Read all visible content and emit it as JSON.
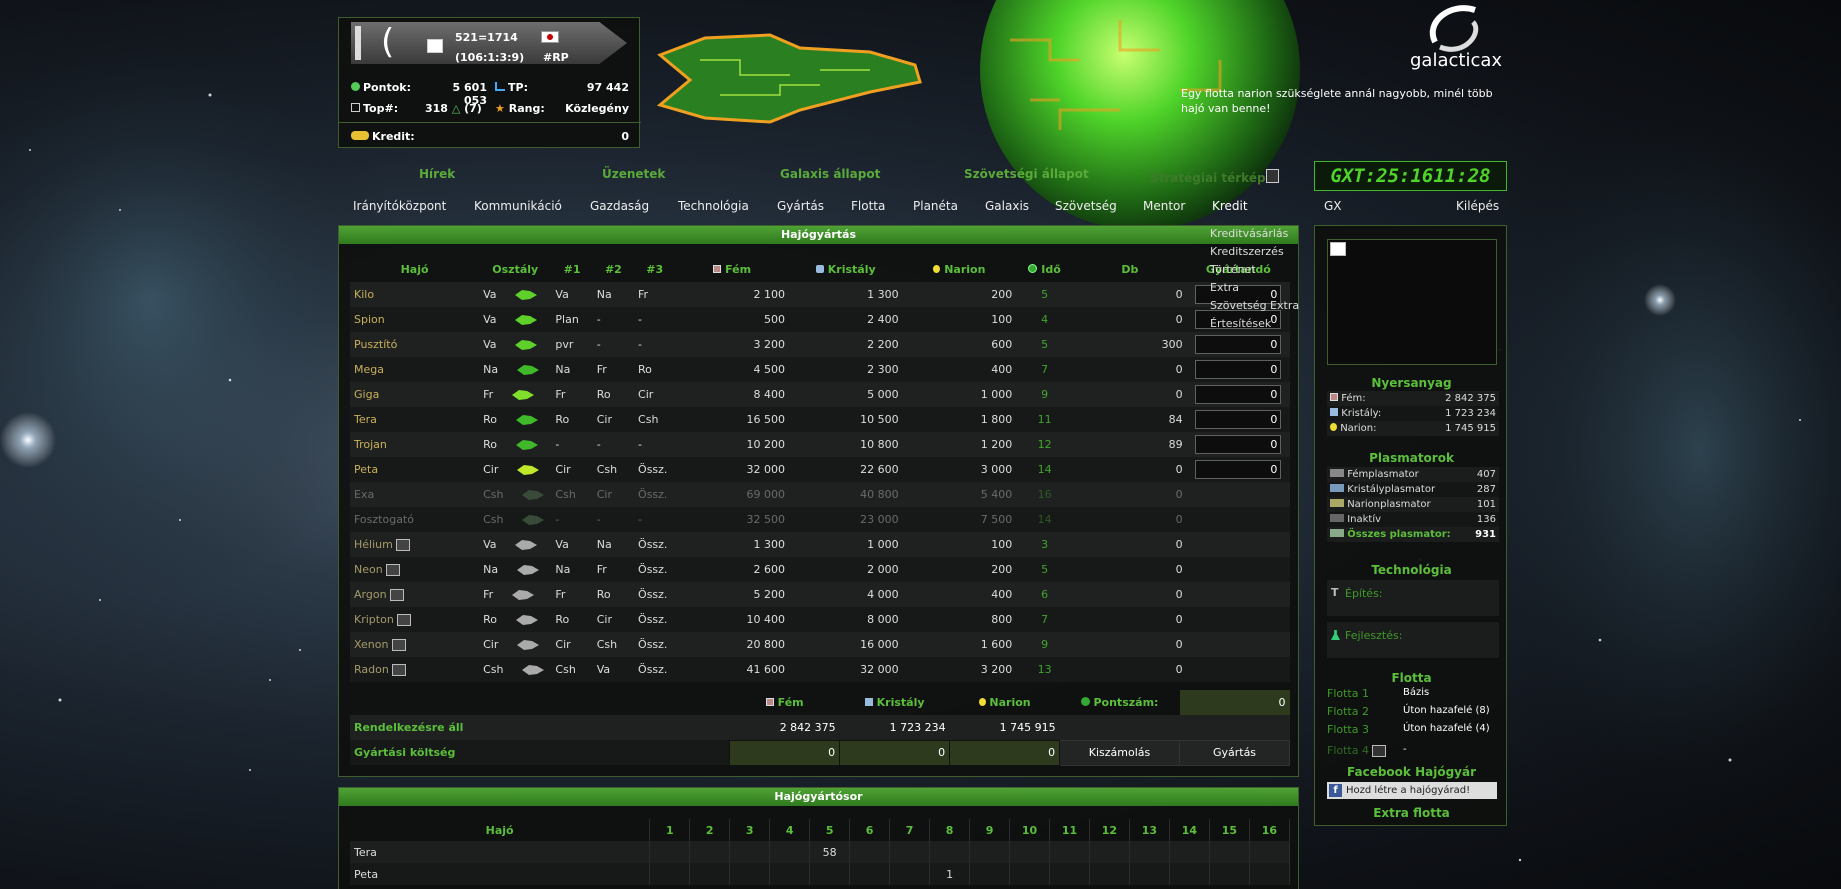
{
  "header": {
    "coord_line1": "521=1714",
    "coord_line2": "(106:1:3:9)",
    "tag": "#RP",
    "stats": [
      {
        "label": "Pontok:",
        "value": "5 601 053"
      },
      {
        "label": "TP:",
        "value": "97 442"
      },
      {
        "label": "Top#:",
        "value": "318",
        "extra": "(7)"
      },
      {
        "label": "Rang:",
        "value": "Közlegény"
      },
      {
        "label": "Kredit:",
        "value": "0"
      }
    ],
    "logo": "galacticax",
    "tip": "Egy flotta narion szükséglete annál nagyobb, minél több hajó van benne!",
    "clock": "GXT:25:1611:28"
  },
  "subnav": [
    "Hírek",
    "Üzenetek",
    "Galaxis állapot",
    "Szövetségi állapot",
    "Stratégiai térkép"
  ],
  "nav": [
    "Irányítóközpont",
    "Kommunikáció",
    "Gazdaság",
    "Technológia",
    "Gyártás",
    "Flotta",
    "Planéta",
    "Galaxis",
    "Szövetség",
    "Mentor",
    "Kredit",
    "GX",
    "Kilépés"
  ],
  "kredit_menu": [
    "Kreditvásárlás",
    "Kreditszerzés",
    "Történet",
    "Extra",
    "Szövetség Extra",
    "Értesítések"
  ],
  "production": {
    "title": "Hajógyártás",
    "columns": [
      "Hajó",
      "Osztály",
      "#1",
      "#2",
      "#3",
      "Fém",
      "Kristály",
      "Narion",
      "Idő",
      "Db",
      "Gyártandó"
    ],
    "ships": [
      {
        "name": "Kilo",
        "cls": "Va",
        "t1": "Va",
        "t2": "Na",
        "t3": "Fr",
        "fem": "2 100",
        "kris": "1 300",
        "nar": "200",
        "ido": "5",
        "db": "0",
        "q": "0",
        "dim": false,
        "color": "#5fcf2a"
      },
      {
        "name": "Spion",
        "cls": "Va",
        "t1": "Plan",
        "t2": "-",
        "t3": "-",
        "fem": "500",
        "kris": "2 400",
        "nar": "100",
        "ido": "4",
        "db": "0",
        "q": "0",
        "dim": false,
        "color": "#5fcf2a"
      },
      {
        "name": "Pusztító",
        "cls": "Va",
        "t1": "pvr",
        "t2": "-",
        "t3": "-",
        "fem": "3 200",
        "kris": "2 200",
        "nar": "600",
        "ido": "5",
        "db": "300",
        "q": "0",
        "dim": false,
        "color": "#5fcf2a"
      },
      {
        "name": "Mega",
        "cls": "Na",
        "t1": "Na",
        "t2": "Fr",
        "t3": "Ro",
        "fem": "4 500",
        "kris": "2 300",
        "nar": "400",
        "ido": "7",
        "db": "0",
        "q": "0",
        "dim": false,
        "color": "#3fb82a"
      },
      {
        "name": "Giga",
        "cls": "Fr",
        "t1": "Fr",
        "t2": "Ro",
        "t3": "Cir",
        "fem": "8 400",
        "kris": "5 000",
        "nar": "1 000",
        "ido": "9",
        "db": "0",
        "q": "0",
        "dim": false,
        "color": "#7fdf2a"
      },
      {
        "name": "Tera",
        "cls": "Ro",
        "t1": "Ro",
        "t2": "Cir",
        "t3": "Csh",
        "fem": "16 500",
        "kris": "10 500",
        "nar": "1 800",
        "ido": "11",
        "db": "84",
        "q": "0",
        "dim": false,
        "color": "#3fb82a"
      },
      {
        "name": "Trojan",
        "cls": "Ro",
        "t1": "-",
        "t2": "-",
        "t3": "-",
        "fem": "10 200",
        "kris": "10 800",
        "nar": "1 200",
        "ido": "12",
        "db": "89",
        "q": "0",
        "dim": false,
        "color": "#3fb82a"
      },
      {
        "name": "Peta",
        "cls": "Cir",
        "t1": "Cir",
        "t2": "Csh",
        "t3": "Össz.",
        "fem": "32 000",
        "kris": "22 600",
        "nar": "3 000",
        "ido": "14",
        "db": "0",
        "q": "0",
        "dim": false,
        "color": "#bfe82a"
      },
      {
        "name": "Exa",
        "cls": "Csh",
        "t1": "Csh",
        "t2": "Cir",
        "t3": "Össz.",
        "fem": "69 000",
        "kris": "40 800",
        "nar": "5 400",
        "ido": "16",
        "db": "0",
        "q": "",
        "dim": true,
        "color": "#3a4a3a"
      },
      {
        "name": "Fosztogató",
        "cls": "Csh",
        "t1": "-",
        "t2": "-",
        "t3": "-",
        "fem": "32 500",
        "kris": "23 000",
        "nar": "7 500",
        "ido": "14",
        "db": "0",
        "q": "",
        "dim": true,
        "color": "#3a4a3a"
      },
      {
        "name": "Hélium",
        "cls": "Va",
        "t1": "Va",
        "t2": "Na",
        "t3": "Össz.",
        "fem": "1 300",
        "kris": "1 000",
        "nar": "100",
        "ido": "3",
        "db": "0",
        "q": "",
        "dim": false,
        "color": "#aaaaaa"
      },
      {
        "name": "Neon",
        "cls": "Na",
        "t1": "Na",
        "t2": "Fr",
        "t3": "Össz.",
        "fem": "2 600",
        "kris": "2 000",
        "nar": "200",
        "ido": "5",
        "db": "0",
        "q": "",
        "dim": false,
        "color": "#aaaaaa"
      },
      {
        "name": "Argon",
        "cls": "Fr",
        "t1": "Fr",
        "t2": "Ro",
        "t3": "Össz.",
        "fem": "5 200",
        "kris": "4 000",
        "nar": "400",
        "ido": "6",
        "db": "0",
        "q": "",
        "dim": false,
        "color": "#aaaaaa"
      },
      {
        "name": "Kripton",
        "cls": "Ro",
        "t1": "Ro",
        "t2": "Cir",
        "t3": "Össz.",
        "fem": "10 400",
        "kris": "8 000",
        "nar": "800",
        "ido": "7",
        "db": "0",
        "q": "",
        "dim": false,
        "color": "#aaaaaa"
      },
      {
        "name": "Xenon",
        "cls": "Cir",
        "t1": "Cir",
        "t2": "Csh",
        "t3": "Össz.",
        "fem": "20 800",
        "kris": "16 000",
        "nar": "1 600",
        "ido": "9",
        "db": "0",
        "q": "",
        "dim": false,
        "color": "#aaaaaa"
      },
      {
        "name": "Radon",
        "cls": "Csh",
        "t1": "Csh",
        "t2": "Va",
        "t3": "Össz.",
        "fem": "41 600",
        "kris": "32 000",
        "nar": "3 200",
        "ido": "13",
        "db": "0",
        "q": "",
        "dim": false,
        "color": "#aaaaaa"
      }
    ],
    "totals": {
      "labels": {
        "fem": "Fém",
        "kris": "Kristály",
        "nar": "Narion",
        "points": "Pontszám:"
      },
      "points_value": "0",
      "available_label": "Rendelkezésre áll",
      "available": [
        "2 842 375",
        "1 723 234",
        "1 745 915"
      ],
      "cost_label": "Gyártási költség",
      "cost": [
        "0",
        "0",
        "0"
      ],
      "calc_button": "Kiszámolás",
      "produce_button": "Gyártás"
    }
  },
  "queue": {
    "title": "Hajógyártósor",
    "col_ship": "Hajó",
    "ticks": [
      "1",
      "2",
      "3",
      "4",
      "5",
      "6",
      "7",
      "8",
      "9",
      "10",
      "11",
      "12",
      "13",
      "14",
      "15",
      "16"
    ],
    "rows": [
      {
        "ship": "Tera",
        "tick_index": 4,
        "count": "58"
      },
      {
        "ship": "Peta",
        "tick_index": 7,
        "count": "1"
      }
    ]
  },
  "side": {
    "resources_title": "Nyersanyag",
    "resources": [
      {
        "label": "Fém:",
        "value": "2 842 375"
      },
      {
        "label": "Kristály:",
        "value": "1 723 234"
      },
      {
        "label": "Narion:",
        "value": "1 745 915"
      }
    ],
    "plasma_title": "Plasmatorok",
    "plasma": [
      {
        "label": "Fémplasmator",
        "value": "407"
      },
      {
        "label": "Kristályplasmator",
        "value": "287"
      },
      {
        "label": "Narionplasmator",
        "value": "101"
      },
      {
        "label": "Inaktív",
        "value": "136"
      },
      {
        "label": "Összes plasmator:",
        "value": "931"
      }
    ],
    "tech_title": "Technológia",
    "tech_build": "Építés:",
    "tech_research": "Fejlesztés:",
    "fleet_title": "Flotta",
    "fleets": [
      {
        "name": "Flotta 1",
        "status": "Bázis"
      },
      {
        "name": "Flotta 2",
        "status": "Úton hazafelé (8)"
      },
      {
        "name": "Flotta 3",
        "status": "Úton hazafelé (4)"
      },
      {
        "name": "Flotta 4",
        "status": "-"
      }
    ],
    "fb_title": "Facebook Hajógyár",
    "fb_button": "Hozd létre a hajógyárad!",
    "extra_title": "Extra flotta"
  }
}
